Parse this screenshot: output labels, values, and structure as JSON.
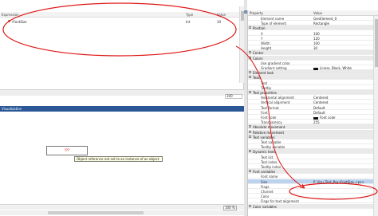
{
  "watch": {
    "columns": {
      "expression": "Expression",
      "type": "Type",
      "value": "Value"
    },
    "rows": [
      {
        "expression": "rFontSize",
        "type": "Int",
        "value": "10"
      }
    ],
    "footer_label": "",
    "zoom": "100"
  },
  "visualization": {
    "tab": "Visualization",
    "element_text": "???",
    "error_tooltip": "Object reference not set to an instance of an object.",
    "zoom": "100 %"
  },
  "properties": {
    "columns": {
      "property": "Property",
      "value": "Value"
    },
    "rows": [
      {
        "kind": "item",
        "name": "Element name",
        "value": "GenElement_0"
      },
      {
        "kind": "item",
        "name": "Type of element",
        "value": "Rectangle"
      },
      {
        "kind": "cat",
        "name": "Position",
        "value": ""
      },
      {
        "kind": "item",
        "name": "X",
        "value": "100"
      },
      {
        "kind": "item",
        "name": "Y",
        "value": "120"
      },
      {
        "kind": "item",
        "name": "Width",
        "value": "100"
      },
      {
        "kind": "item",
        "name": "Height",
        "value": "30"
      },
      {
        "kind": "cat",
        "name": "Center",
        "value": ""
      },
      {
        "kind": "cat",
        "name": "Colors",
        "value": ""
      },
      {
        "kind": "item",
        "name": "Use gradient color",
        "value": ""
      },
      {
        "kind": "item",
        "name": "Gradient setting",
        "value": "Linear, Black, White",
        "swatch": "#111111"
      },
      {
        "kind": "cat",
        "name": "Element look",
        "value": ""
      },
      {
        "kind": "cat",
        "name": "Texts",
        "value": ""
      },
      {
        "kind": "item",
        "name": "Text",
        "value": ""
      },
      {
        "kind": "item",
        "name": "Tooltip",
        "value": ""
      },
      {
        "kind": "cat",
        "name": "Text properties",
        "value": ""
      },
      {
        "kind": "item",
        "name": "Horizontal alignment",
        "value": "Centered"
      },
      {
        "kind": "item",
        "name": "Vertical alignment",
        "value": "Centered"
      },
      {
        "kind": "item",
        "name": "Text format",
        "value": "Default"
      },
      {
        "kind": "item",
        "name": "Font",
        "value": "Default"
      },
      {
        "kind": "item",
        "name": "Font color",
        "value": "Font color",
        "swatch": "#111111"
      },
      {
        "kind": "item",
        "name": "Transparency",
        "value": "255"
      },
      {
        "kind": "cat",
        "name": "Absolute movement",
        "value": ""
      },
      {
        "kind": "cat",
        "name": "Relative movement",
        "value": ""
      },
      {
        "kind": "cat",
        "name": "Text variables",
        "value": ""
      },
      {
        "kind": "item",
        "name": "Text variable",
        "value": ""
      },
      {
        "kind": "item",
        "name": "Tooltip variable",
        "value": ""
      },
      {
        "kind": "cat",
        "name": "Dynamic texts",
        "value": ""
      },
      {
        "kind": "item",
        "name": "Text list",
        "value": ""
      },
      {
        "kind": "item",
        "name": "Text index",
        "value": ""
      },
      {
        "kind": "item",
        "name": "Tooltip index",
        "value": ""
      },
      {
        "kind": "cat",
        "name": "Font variables",
        "value": ""
      },
      {
        "kind": "item",
        "name": "Font name",
        "value": ""
      },
      {
        "kind": "item",
        "name": "Size",
        "value": "P_Visu_Test_Prg.rFontSize <px>",
        "selected": true
      },
      {
        "kind": "item",
        "name": "Flags",
        "value": ""
      },
      {
        "kind": "item",
        "name": "Charset",
        "value": ""
      },
      {
        "kind": "item",
        "name": "Color",
        "value": ""
      },
      {
        "kind": "item",
        "name": "Flags for text alignment",
        "value": ""
      },
      {
        "kind": "cat",
        "name": "Color variables",
        "value": ""
      }
    ]
  }
}
